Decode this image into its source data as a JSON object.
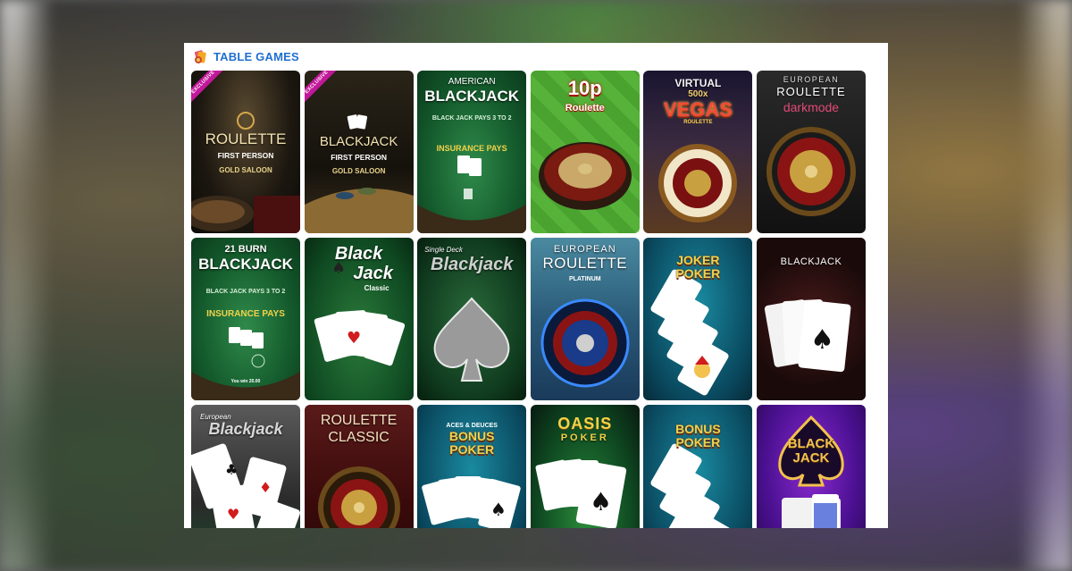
{
  "header": {
    "title": "TABLE GAMES",
    "icon": "cards-chips-icon"
  },
  "colors": {
    "title": "#1f6fd1",
    "badge": "#c2189a"
  },
  "tiles": [
    {
      "title": "ROULETTE",
      "sub1": "FIRST PERSON",
      "sub2": "GOLD SALOON",
      "badge": "EXCLUSIVE"
    },
    {
      "title": "BLACKJACK",
      "sub1": "FIRST PERSON",
      "sub2": "GOLD SALOON",
      "badge": "EXCLUSIVE"
    },
    {
      "title": "AMERICAN",
      "sub1": "BLACKJACK",
      "sub2": "BLACK JACK PAYS 3 TO 2",
      "sub3": "INSURANCE PAYS"
    },
    {
      "title": "10p",
      "sub1": "Roulette"
    },
    {
      "title": "VIRTUAL",
      "sub1": "500x",
      "sub2": "VEGAS",
      "sub3": "ROULETTE"
    },
    {
      "title": "EUROPEAN",
      "sub1": "ROULETTE",
      "sub2": "darkmode"
    },
    {
      "title": "21 BURN",
      "sub1": "BLACKJACK",
      "sub2": "BLACK JACK PAYS 3 TO 2",
      "sub3": "INSURANCE PAYS",
      "sub4": "You win 20.00"
    },
    {
      "title": "Black",
      "sub1": "Jack",
      "sub2": "Classic"
    },
    {
      "title": "Single Deck",
      "sub1": "Blackjack"
    },
    {
      "title": "EUROPEAN",
      "sub1": "ROULETTE",
      "sub2": "PLATINUM"
    },
    {
      "title": "JOKER",
      "sub1": "POKER"
    },
    {
      "title": "BLACKJACK"
    },
    {
      "title": "European",
      "sub1": "Blackjack"
    },
    {
      "title": "ROULETTE",
      "sub1": "CLASSIC"
    },
    {
      "title": "ACES & DEUCES",
      "sub1": "BONUS",
      "sub2": "POKER"
    },
    {
      "title": "OASIS",
      "sub1": "POKER"
    },
    {
      "title": "BONUS",
      "sub1": "POKER"
    },
    {
      "title": "BLACK",
      "sub1": "JACK"
    }
  ]
}
